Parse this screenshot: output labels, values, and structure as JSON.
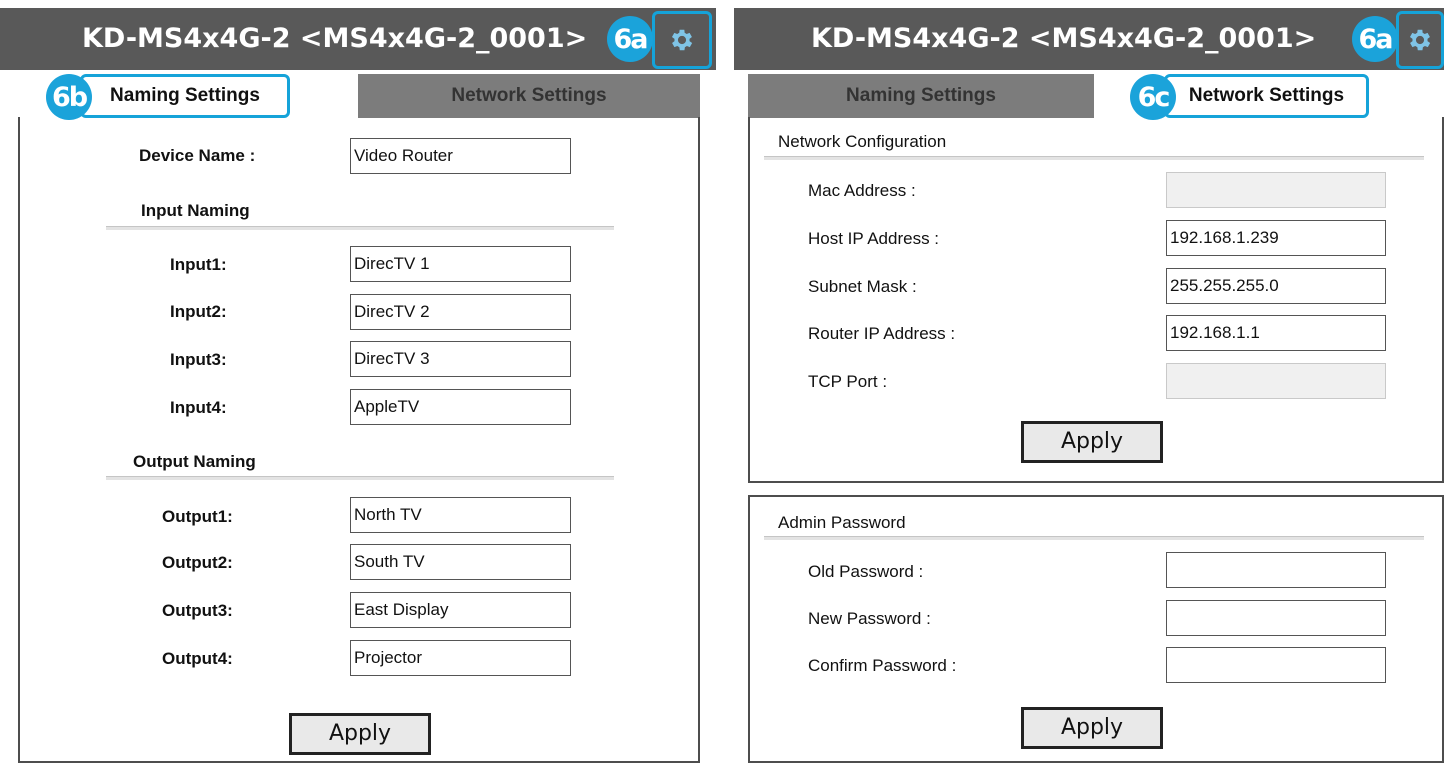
{
  "left_panel": {
    "title": "KD-MS4x4G-2 <MS4x4G-2_0001>",
    "gear_badge": "6a",
    "tabs": {
      "naming": {
        "label": "Naming Settings",
        "badge": "6b"
      },
      "network": {
        "label": "Network Settings"
      }
    },
    "device_name": {
      "label": "Device Name :",
      "value": "Video Router"
    },
    "input_naming": {
      "heading": "Input Naming",
      "items": [
        {
          "label": "Input1:",
          "value": "DirecTV 1"
        },
        {
          "label": "Input2:",
          "value": "DirecTV 2"
        },
        {
          "label": "Input3:",
          "value": "DirecTV 3"
        },
        {
          "label": "Input4:",
          "value": "AppleTV"
        }
      ]
    },
    "output_naming": {
      "heading": "Output Naming",
      "items": [
        {
          "label": "Output1:",
          "value": "North TV"
        },
        {
          "label": "Output2:",
          "value": "South TV"
        },
        {
          "label": "Output3:",
          "value": "East Display"
        },
        {
          "label": "Output4:",
          "value": "Projector"
        }
      ]
    },
    "apply_label": "Apply"
  },
  "right_panel": {
    "title": "KD-MS4x4G-2 <MS4x4G-2_0001>",
    "gear_badge": "6a",
    "tabs": {
      "naming": {
        "label": "Naming Settings"
      },
      "network": {
        "label": "Network Settings",
        "badge": "6c"
      }
    },
    "network_config": {
      "heading": "Network Configuration",
      "fields": [
        {
          "label": "Mac Address :",
          "value": ""
        },
        {
          "label": "Host IP Address :",
          "value": "192.168.1.239"
        },
        {
          "label": "Subnet Mask :",
          "value": "255.255.255.0"
        },
        {
          "label": "Router IP Address :",
          "value": "192.168.1.1"
        },
        {
          "label": "TCP Port :",
          "value": ""
        }
      ],
      "apply_label": "Apply"
    },
    "admin_password": {
      "heading": "Admin Password",
      "fields": [
        {
          "label": "Old Password :",
          "value": ""
        },
        {
          "label": "New Password :",
          "value": ""
        },
        {
          "label": "Confirm Password :",
          "value": ""
        }
      ],
      "apply_label": "Apply"
    }
  },
  "colors": {
    "header_bg": "#595959",
    "accent": "#1ba3da",
    "inactive_tab": "#7c7c7c"
  },
  "icons": {
    "gear": "gear-icon"
  }
}
